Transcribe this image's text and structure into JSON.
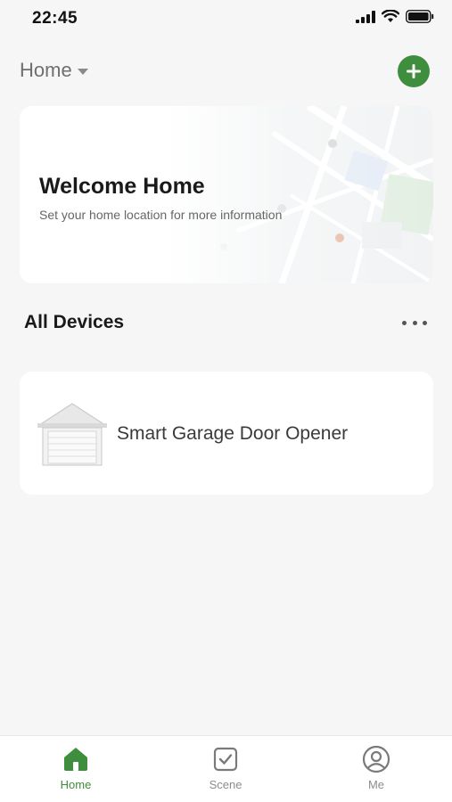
{
  "status_bar": {
    "time": "22:45",
    "icons": [
      "signal-icon",
      "wifi-icon",
      "battery-icon"
    ]
  },
  "header": {
    "home_label": "Home",
    "add_icon": "plus-icon",
    "accent_color": "#3e8e3e"
  },
  "welcome_card": {
    "title": "Welcome Home",
    "subtitle": "Set your home location for more information"
  },
  "devices_section": {
    "title": "All Devices",
    "more_icon": "more-dots-icon",
    "devices": [
      {
        "name": "Smart Garage Door Opener",
        "icon": "garage-door-icon"
      }
    ]
  },
  "tab_bar": {
    "tabs": [
      {
        "label": "Home",
        "icon": "home-icon",
        "active": true
      },
      {
        "label": "Scene",
        "icon": "scene-checkbox-icon",
        "active": false
      },
      {
        "label": "Me",
        "icon": "user-profile-icon",
        "active": false
      }
    ]
  }
}
